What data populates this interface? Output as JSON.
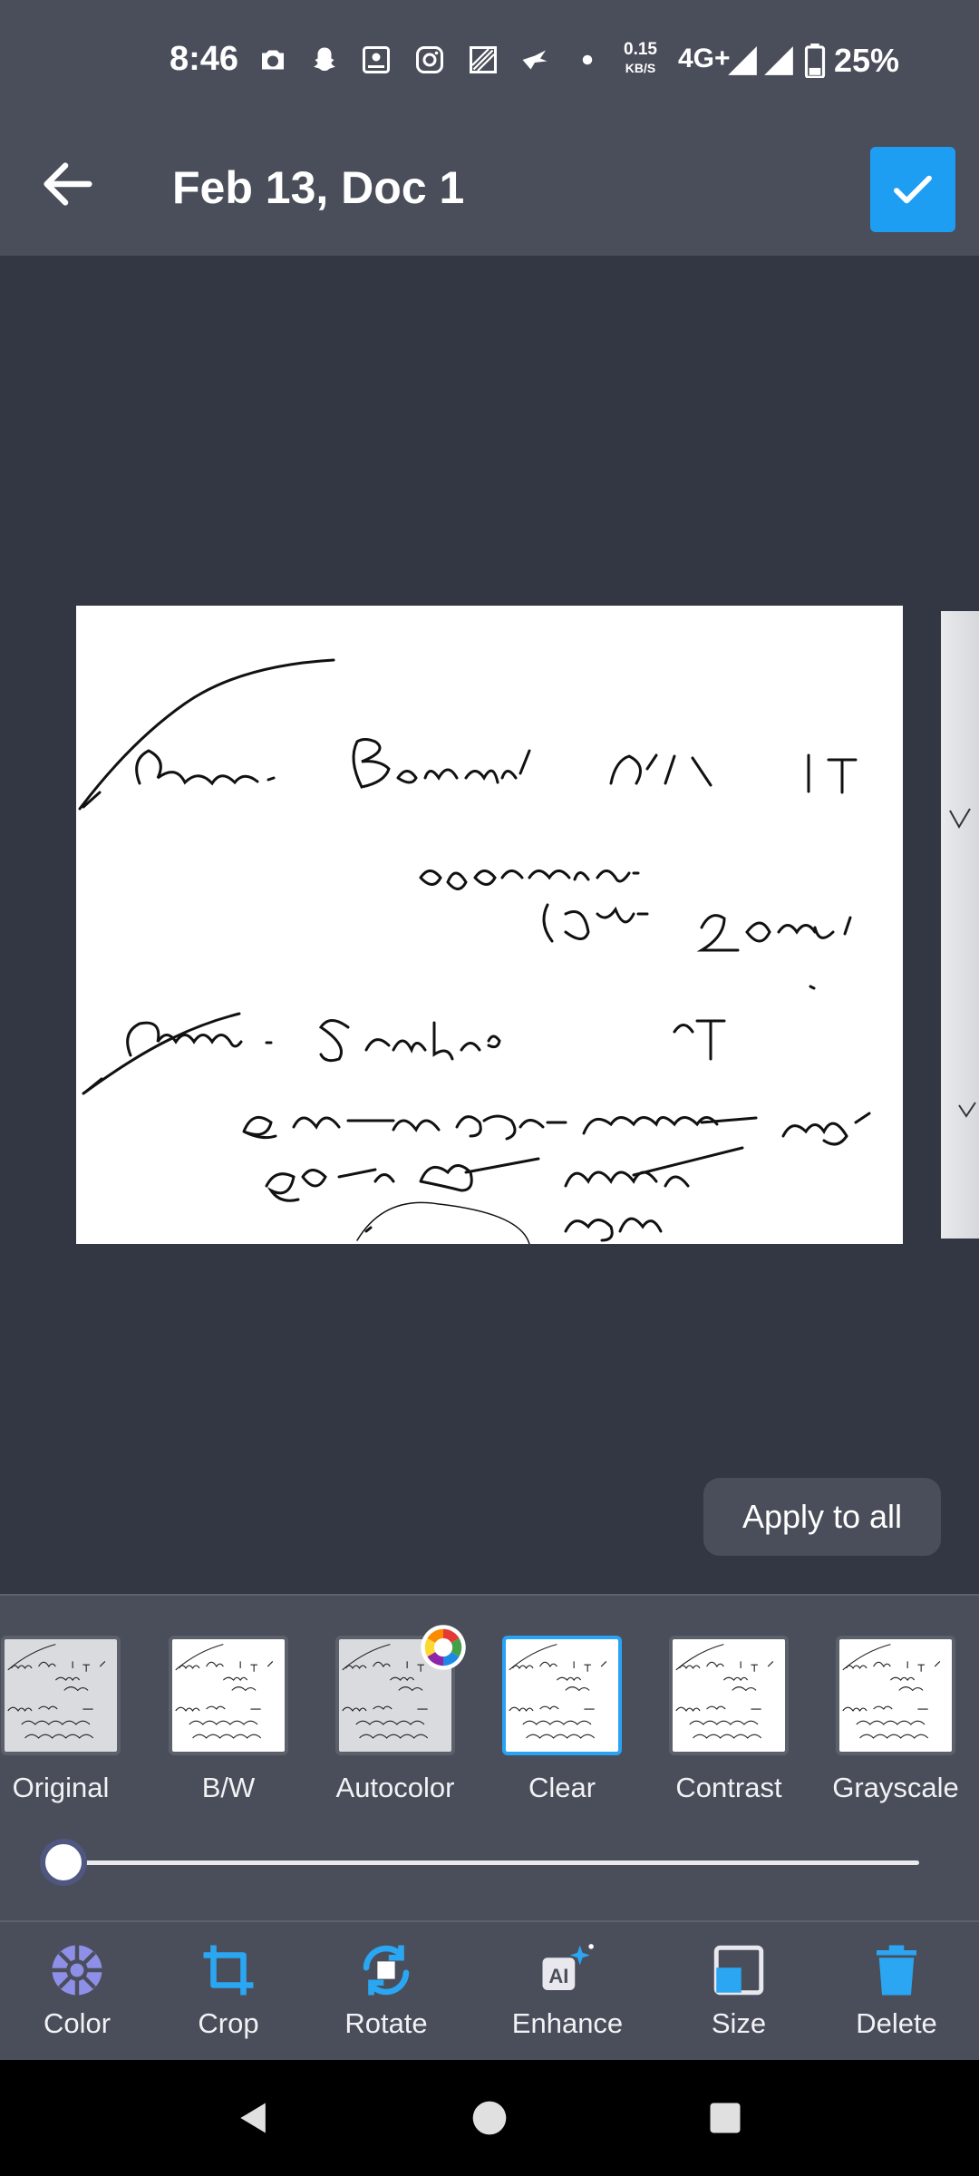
{
  "status_bar": {
    "time": "8:46",
    "speed_value": "0.15",
    "speed_unit": "KB/S",
    "network": "4G+",
    "battery_percent": "25%",
    "notification_icons": [
      "camera-icon",
      "snapchat-icon",
      "app-icon",
      "instagram-icon",
      "pattern-app-icon",
      "bird-icon",
      "dot-icon"
    ]
  },
  "app_bar": {
    "title": "Feb 13, Doc 1",
    "back_icon": "arrow-left-icon",
    "confirm_icon": "check-icon"
  },
  "document": {
    "handwriting_lines": [
      "Ceem. Benorali Dr.   IT",
      "Opsonin.",
      "Rx 2020",
      "Ceem. Scabies   IT",
      "Bengali handwritten note line 1",
      "Bengali handwritten note line 2"
    ]
  },
  "apply_all_label": "Apply to all",
  "filters": [
    {
      "label": "Original",
      "selected": false
    },
    {
      "label": "B/W",
      "selected": false
    },
    {
      "label": "Autocolor",
      "selected": false
    },
    {
      "label": "Clear",
      "selected": true
    },
    {
      "label": "Contrast",
      "selected": false
    },
    {
      "label": "Grayscale",
      "selected": false
    }
  ],
  "intensity_level": 0,
  "toolbar": [
    {
      "label": "Color",
      "icon": "palette-wheel-icon"
    },
    {
      "label": "Crop",
      "icon": "crop-icon"
    },
    {
      "label": "Rotate",
      "icon": "rotate-icon"
    },
    {
      "label": "Enhance",
      "icon": "ai-enhance-icon"
    },
    {
      "label": "Size",
      "icon": "page-size-icon"
    },
    {
      "label": "Delete",
      "icon": "trash-icon"
    }
  ],
  "colors": {
    "accent": "#1e9ef3",
    "toolbar_icon": "#2aa6f2",
    "panel": "#4a4e5a",
    "canvas": "#333744"
  }
}
